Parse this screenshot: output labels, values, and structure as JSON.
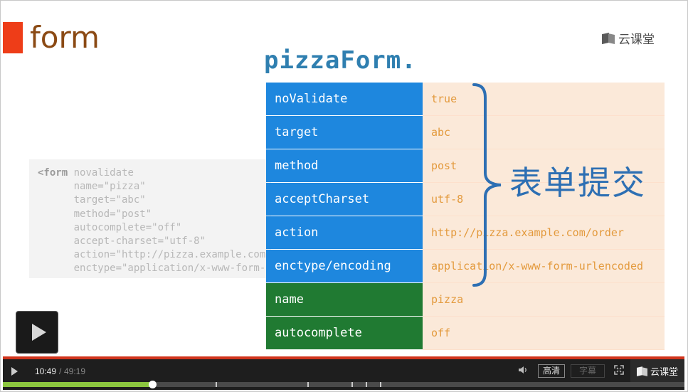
{
  "slide": {
    "title": "form",
    "brand": "云课堂",
    "heading": "pizzaForm.",
    "annotation": "表单提交",
    "code_lines": [
      {
        "kw": "<form",
        "rest": " novalidate"
      },
      {
        "kw": "",
        "rest": "      name=\"pizza\""
      },
      {
        "kw": "",
        "rest": "      target=\"abc\""
      },
      {
        "kw": "",
        "rest": "      method=\"post\""
      },
      {
        "kw": "",
        "rest": "      autocomplete=\"off\""
      },
      {
        "kw": "",
        "rest": "      accept-charset=\"utf-8\""
      },
      {
        "kw": "",
        "rest": "      action=\"http://pizza.example.com/order\""
      },
      {
        "kw": "",
        "rest": "      enctype=\"application/x-www-form-urlencoded\""
      }
    ],
    "properties": [
      {
        "key": "noValidate",
        "value": "true",
        "group": "blue"
      },
      {
        "key": "target",
        "value": "abc",
        "group": "blue"
      },
      {
        "key": "method",
        "value": "post",
        "group": "blue"
      },
      {
        "key": "acceptCharset",
        "value": "utf-8",
        "group": "blue"
      },
      {
        "key": "action",
        "value": "http://pizza.example.com/order",
        "group": "blue"
      },
      {
        "key": "enctype/encoding",
        "value": "application/x-www-form-urlencoded",
        "group": "blue"
      },
      {
        "key": "name",
        "value": "pizza",
        "group": "green"
      },
      {
        "key": "autocomplete",
        "value": "off",
        "group": "green"
      }
    ]
  },
  "player": {
    "time_current": "10:49",
    "time_separator": "/",
    "time_total": "49:19",
    "quality_label": "高清",
    "subtitle_label": "字幕",
    "brand": "云课堂",
    "progress_fraction": 0.2194,
    "chapter_marks": [
      0.3125,
      0.4469,
      0.5115,
      0.5323,
      0.5531
    ],
    "icons": [
      "play-icon",
      "volume-icon",
      "fullscreen-icon",
      "brand-logo-icon"
    ]
  },
  "colors": {
    "accent_red": "#ee3d18",
    "title_brown": "#8b4a14",
    "key_blue": "#1e87de",
    "key_green": "#207a32",
    "value_bg": "#fbe9d9",
    "value_text": "#e39a3d",
    "annotation_blue": "#2d6fb3",
    "progress_green": "#8cc63f"
  }
}
